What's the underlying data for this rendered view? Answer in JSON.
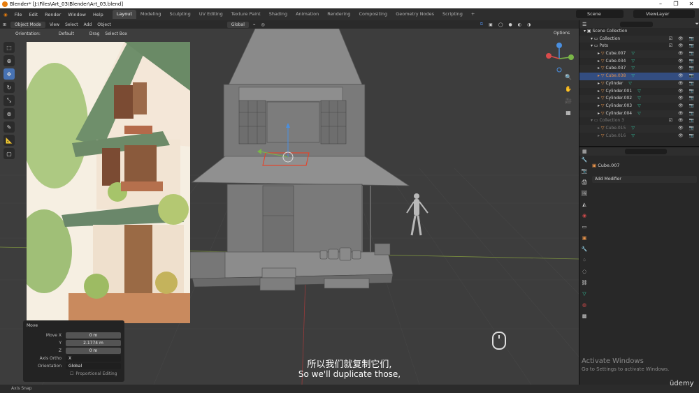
{
  "window": {
    "title": "Blender* [J:\\Files\\Art_03\\Blender\\Art_03.blend]"
  },
  "menu": {
    "items": [
      "File",
      "Edit",
      "Render",
      "Window",
      "Help"
    ],
    "workspaces": [
      "Layout",
      "Modeling",
      "Sculpting",
      "UV Editing",
      "Texture Paint",
      "Shading",
      "Animation",
      "Rendering",
      "Compositing",
      "Geometry Nodes",
      "Scripting"
    ],
    "active_workspace": "Layout",
    "add_tab": "+",
    "scene": "Scene",
    "view_layer": "ViewLayer"
  },
  "viewport_header": {
    "mode": "Object Mode",
    "menus": [
      "View",
      "Select",
      "Add",
      "Object"
    ],
    "transform_orientation": "Global",
    "orientation_label": "Orientation:",
    "orientation_value": "Default",
    "drag_label": "Drag",
    "drag_value": "Select Box",
    "options": "Options"
  },
  "operator_panel": {
    "title": "Move",
    "rows": [
      {
        "label": "Move X",
        "value": "0 m"
      },
      {
        "label": "Y",
        "value": "2.1774 m"
      },
      {
        "label": "Z",
        "value": "0 m"
      }
    ],
    "axis_ortho_label": "Axis Ortho",
    "axis_ortho_value": "X",
    "orientation_label": "Orientation",
    "orientation_value": "Global",
    "proportional_editing": "Proportional Editing"
  },
  "outliner": {
    "rows": [
      {
        "name": "Scene Collection",
        "kind": "scene",
        "depth": 0
      },
      {
        "name": "Collection",
        "kind": "collection",
        "depth": 1
      },
      {
        "name": "Pots",
        "kind": "collection",
        "depth": 1
      },
      {
        "name": "Cube.007",
        "kind": "mesh",
        "depth": 2
      },
      {
        "name": "Cube.034",
        "kind": "mesh",
        "depth": 2
      },
      {
        "name": "Cube.037",
        "kind": "mesh",
        "depth": 2
      },
      {
        "name": "Cube.038",
        "kind": "mesh",
        "depth": 2,
        "selected": true
      },
      {
        "name": "Cylinder",
        "kind": "mesh",
        "depth": 2
      },
      {
        "name": "Cylinder.001",
        "kind": "mesh",
        "depth": 2
      },
      {
        "name": "Cylinder.002",
        "kind": "mesh",
        "depth": 2
      },
      {
        "name": "Cylinder.003",
        "kind": "mesh",
        "depth": 2
      },
      {
        "name": "Cylinder.004",
        "kind": "mesh",
        "depth": 2
      },
      {
        "name": "Collection 3",
        "kind": "collection",
        "depth": 1,
        "dim": true
      },
      {
        "name": "Cube.015",
        "kind": "mesh",
        "depth": 2,
        "dim": true
      },
      {
        "name": "Cube.016",
        "kind": "mesh",
        "depth": 2,
        "dim": true
      }
    ]
  },
  "properties": {
    "object_name": "Cube.007",
    "add_modifier": "Add Modifier"
  },
  "statusbar": {
    "text": "Axis Snap"
  },
  "overlay": {
    "subtitle_cn": "所以我们就复制它们,",
    "subtitle_en": "So we'll duplicate those,",
    "activate_title": "Activate Windows",
    "activate_sub": "Go to Settings to activate Windows.",
    "brand": "üdemy"
  },
  "colors": {
    "accent": "#4772b3",
    "selected_row": "#334d80",
    "mesh_icon": "#e8934a",
    "modifier_icon": "#33c6a0",
    "selection_outline": "#e0472f"
  }
}
